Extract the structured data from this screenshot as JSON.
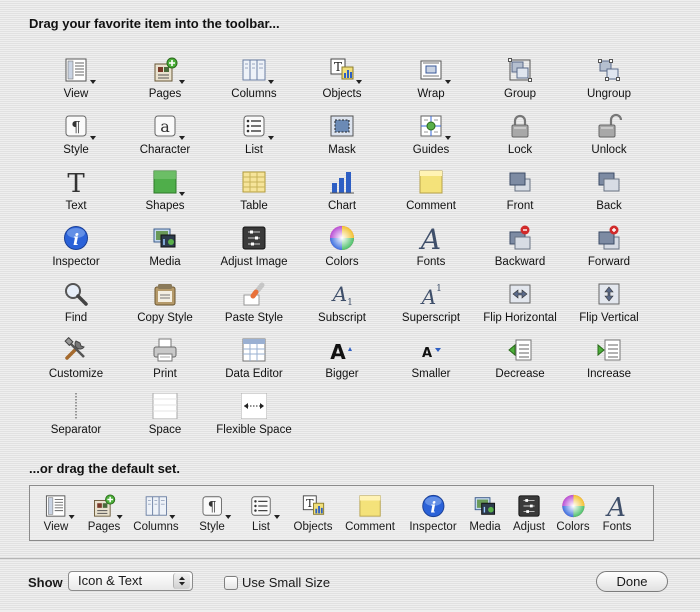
{
  "headings": {
    "top": "Drag your favorite item into the toolbar...",
    "default": "...or drag the default set."
  },
  "palette": [
    {
      "label": "View",
      "icon": "view-icon",
      "menu": true
    },
    {
      "label": "Pages",
      "icon": "pages-icon",
      "menu": true
    },
    {
      "label": "Columns",
      "icon": "columns-icon",
      "menu": true
    },
    {
      "label": "Objects",
      "icon": "objects-icon",
      "menu": true
    },
    {
      "label": "Wrap",
      "icon": "wrap-icon",
      "menu": true
    },
    {
      "label": "Group",
      "icon": "group-icon",
      "menu": false
    },
    {
      "label": "Ungroup",
      "icon": "ungroup-icon",
      "menu": false
    },
    {
      "label": "Style",
      "icon": "style-icon",
      "menu": true
    },
    {
      "label": "Character",
      "icon": "character-icon",
      "menu": true
    },
    {
      "label": "List",
      "icon": "list-icon",
      "menu": true
    },
    {
      "label": "Mask",
      "icon": "mask-icon",
      "menu": false
    },
    {
      "label": "Guides",
      "icon": "guides-icon",
      "menu": true
    },
    {
      "label": "Lock",
      "icon": "lock-icon",
      "menu": false
    },
    {
      "label": "Unlock",
      "icon": "unlock-icon",
      "menu": false
    },
    {
      "label": "Text",
      "icon": "text-icon",
      "menu": false
    },
    {
      "label": "Shapes",
      "icon": "shapes-icon",
      "menu": true
    },
    {
      "label": "Table",
      "icon": "table-icon",
      "menu": false
    },
    {
      "label": "Chart",
      "icon": "chart-icon",
      "menu": false
    },
    {
      "label": "Comment",
      "icon": "comment-icon",
      "menu": false
    },
    {
      "label": "Front",
      "icon": "front-icon",
      "menu": false
    },
    {
      "label": "Back",
      "icon": "back-icon",
      "menu": false
    },
    {
      "label": "Inspector",
      "icon": "inspector-icon",
      "menu": false
    },
    {
      "label": "Media",
      "icon": "media-icon",
      "menu": false
    },
    {
      "label": "Adjust Image",
      "icon": "adjust-image-icon",
      "menu": false
    },
    {
      "label": "Colors",
      "icon": "colors-icon",
      "menu": false
    },
    {
      "label": "Fonts",
      "icon": "fonts-icon",
      "menu": false
    },
    {
      "label": "Backward",
      "icon": "backward-icon",
      "menu": false
    },
    {
      "label": "Forward",
      "icon": "forward-icon",
      "menu": false
    },
    {
      "label": "Find",
      "icon": "find-icon",
      "menu": false
    },
    {
      "label": "Copy Style",
      "icon": "copy-style-icon",
      "menu": false
    },
    {
      "label": "Paste Style",
      "icon": "paste-style-icon",
      "menu": false
    },
    {
      "label": "Subscript",
      "icon": "subscript-icon",
      "menu": false
    },
    {
      "label": "Superscript",
      "icon": "superscript-icon",
      "menu": false
    },
    {
      "label": "Flip Horizontal",
      "icon": "flip-horizontal-icon",
      "menu": false
    },
    {
      "label": "Flip Vertical",
      "icon": "flip-vertical-icon",
      "menu": false
    },
    {
      "label": "Customize",
      "icon": "customize-icon",
      "menu": false
    },
    {
      "label": "Print",
      "icon": "print-icon",
      "menu": false
    },
    {
      "label": "Data Editor",
      "icon": "data-editor-icon",
      "menu": false
    },
    {
      "label": "Bigger",
      "icon": "bigger-icon",
      "menu": false
    },
    {
      "label": "Smaller",
      "icon": "smaller-icon",
      "menu": false
    },
    {
      "label": "Decrease",
      "icon": "decrease-icon",
      "menu": false
    },
    {
      "label": "Increase",
      "icon": "increase-icon",
      "menu": false
    },
    {
      "label": "Separator",
      "icon": "separator-icon",
      "menu": false
    },
    {
      "label": "Space",
      "icon": "space-icon",
      "menu": false
    },
    {
      "label": "Flexible Space",
      "icon": "flexible-space-icon",
      "menu": false
    }
  ],
  "default_set": [
    {
      "label": "View",
      "icon": "view-icon",
      "menu": true
    },
    {
      "label": "Pages",
      "icon": "pages-icon",
      "menu": true
    },
    {
      "label": "Columns",
      "icon": "columns-icon",
      "menu": true
    },
    {
      "label": "Style",
      "icon": "style-icon",
      "menu": true
    },
    {
      "label": "List",
      "icon": "list-icon",
      "menu": true
    },
    {
      "label": "Objects",
      "icon": "objects-icon",
      "menu": false
    },
    {
      "label": "Comment",
      "icon": "comment-icon",
      "menu": false
    },
    {
      "label": "Inspector",
      "icon": "inspector-icon",
      "menu": false
    },
    {
      "label": "Media",
      "icon": "media-icon",
      "menu": false
    },
    {
      "label": "Adjust",
      "icon": "adjust-image-icon",
      "menu": false
    },
    {
      "label": "Colors",
      "icon": "colors-icon",
      "menu": false
    },
    {
      "label": "Fonts",
      "icon": "fonts-icon",
      "menu": false
    }
  ],
  "footer": {
    "show_label": "Show",
    "show_value": "Icon & Text",
    "small_size_label": "Use Small Size",
    "small_size_checked": false,
    "done_label": "Done"
  },
  "colors": {
    "info_blue": "#2b62d8",
    "chart_blue": "#2e5fc4",
    "comment_yellow": "#f4e27a",
    "shape_green": "#4fae4a",
    "badge_red": "#d12a2a"
  }
}
